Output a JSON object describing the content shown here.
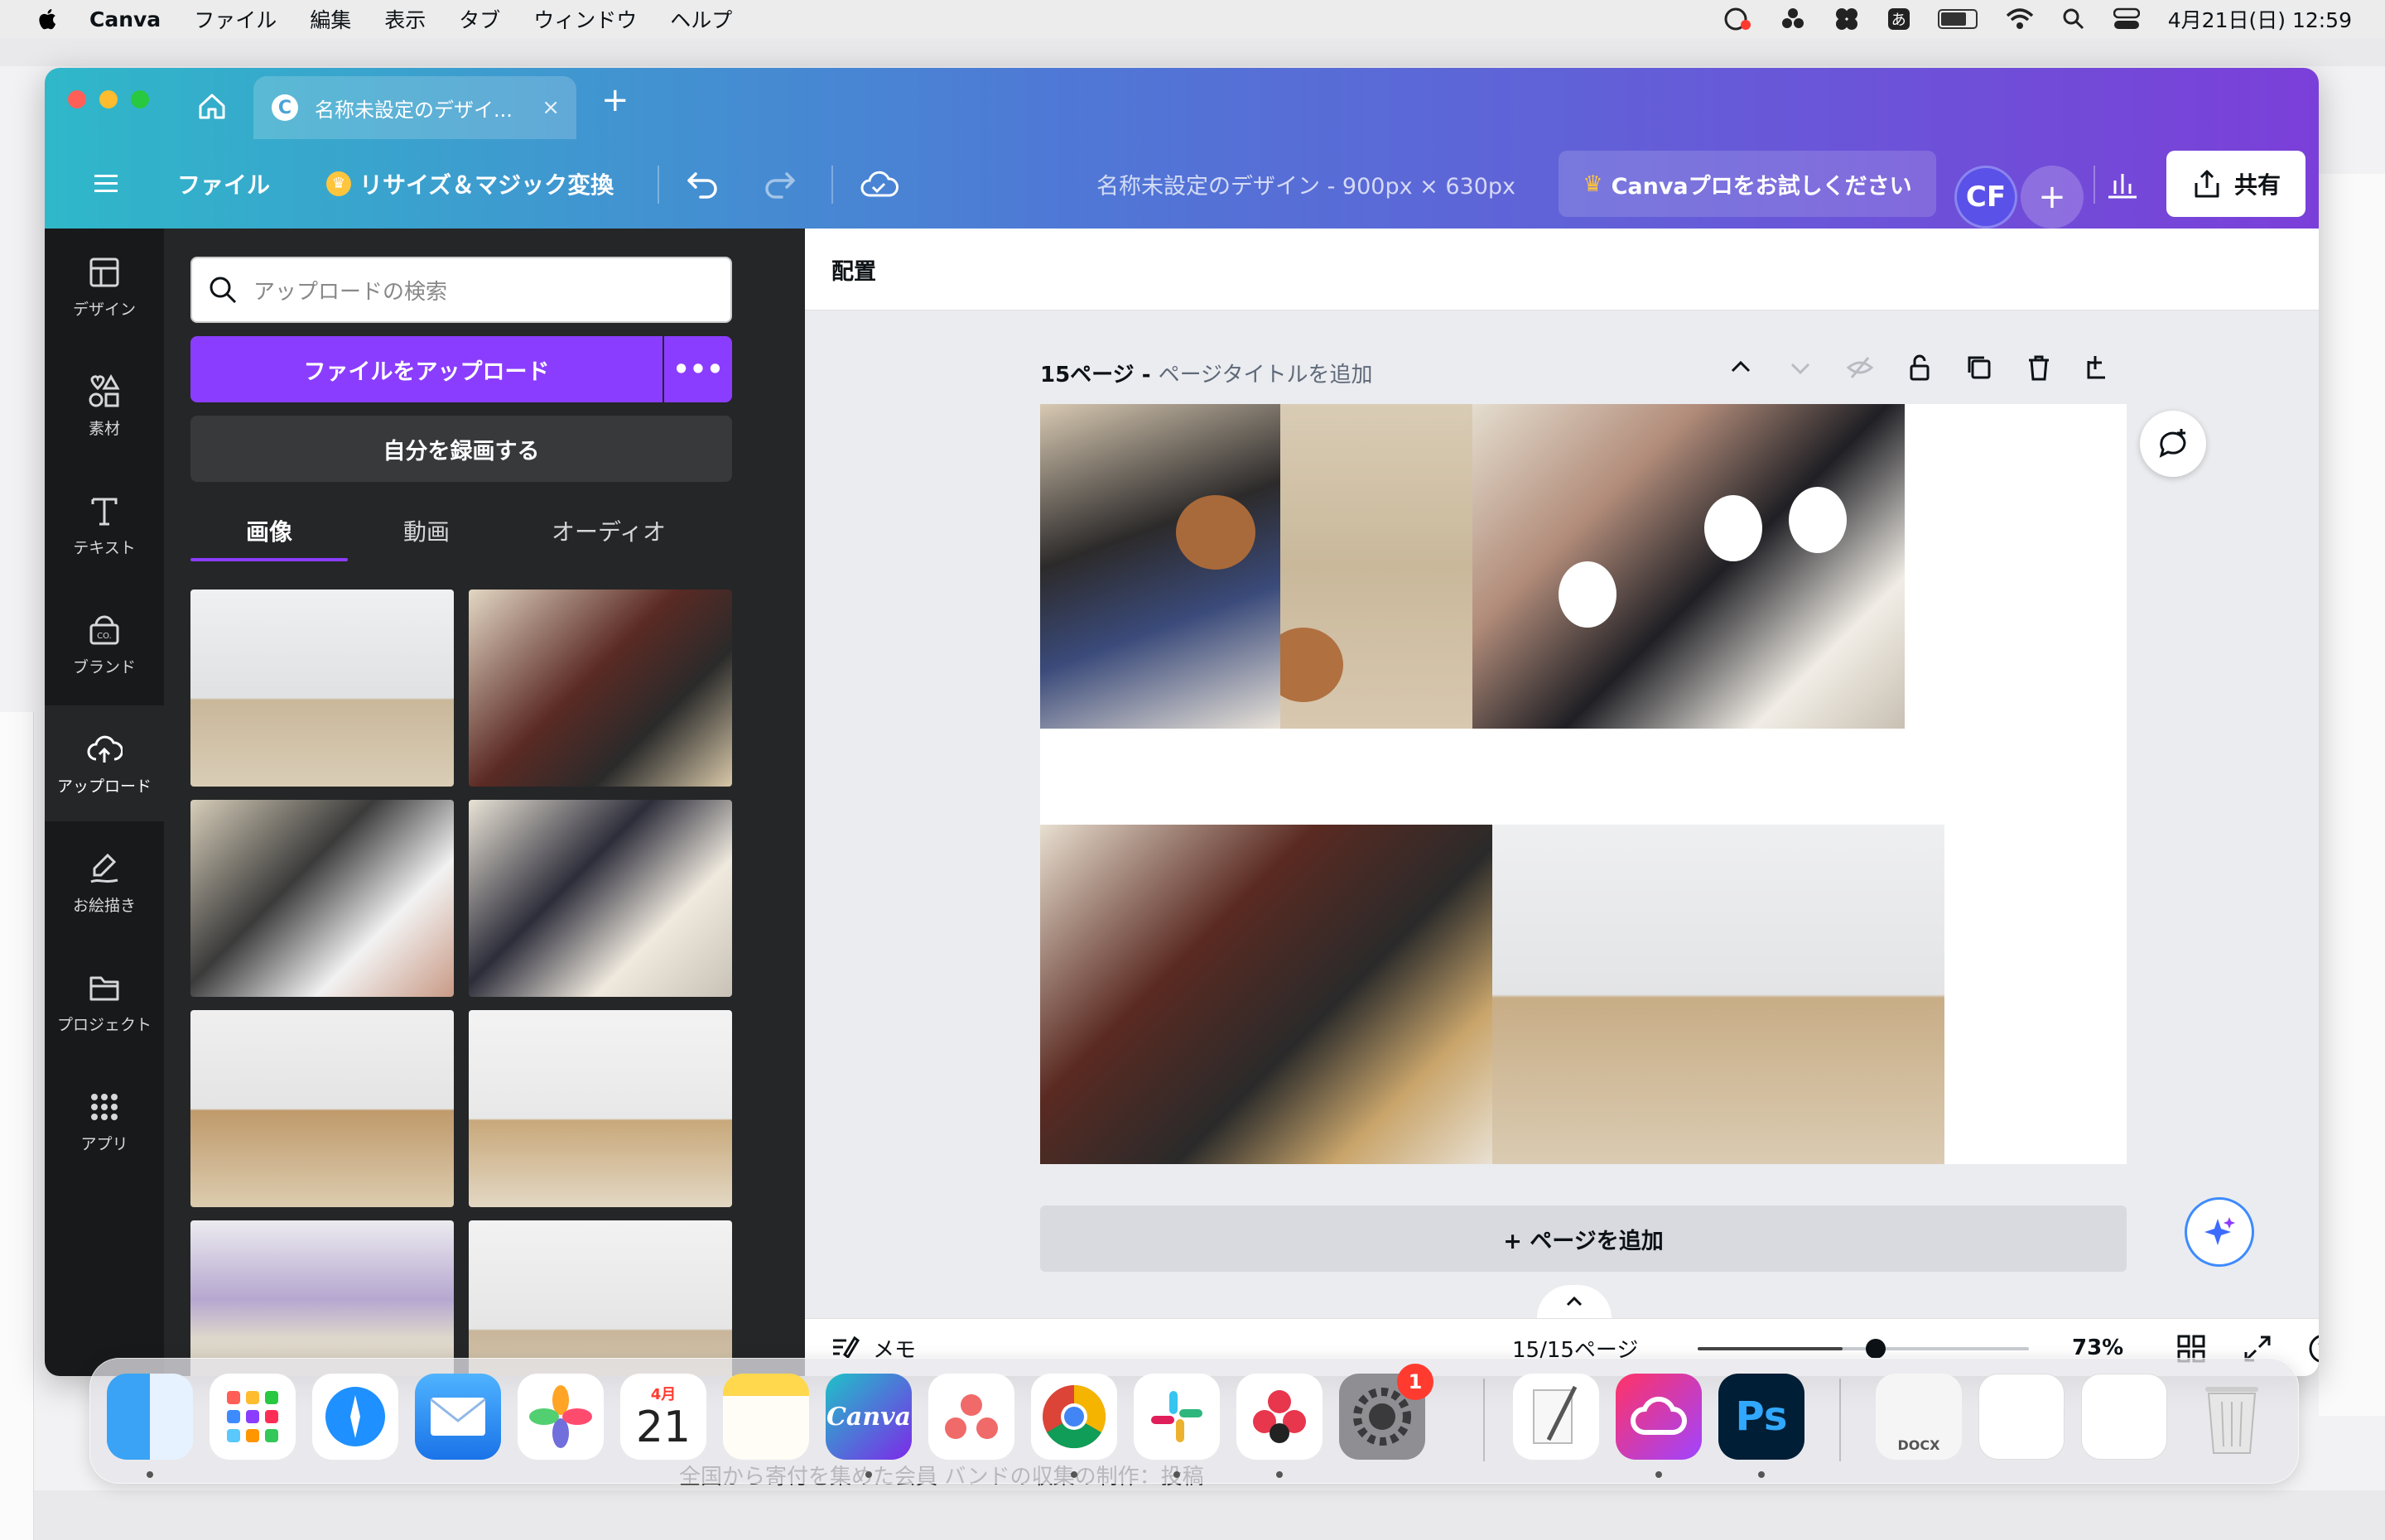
{
  "menubar": {
    "app": "Canva",
    "items": [
      "ファイル",
      "編集",
      "表示",
      "タブ",
      "ウィンドウ",
      "ヘルプ"
    ],
    "ime": "あ",
    "datetime": "4月21日(日)  12:59"
  },
  "browser": {
    "tab_title": "名称未設定のデザイ...",
    "tab_close": "×",
    "new_tab": "+"
  },
  "toolbar": {
    "file": "ファイル",
    "resize": "リサイズ＆マジック変換",
    "design_title": "名称未設定のデザイン - 900px × 630px",
    "pro": "Canvaプロをお試しください",
    "avatar": "CF",
    "add": "+",
    "share": "共有"
  },
  "rail": [
    {
      "label": "デザイン",
      "icon": "layout-icon"
    },
    {
      "label": "素材",
      "icon": "elements-icon"
    },
    {
      "label": "テキスト",
      "icon": "text-icon"
    },
    {
      "label": "ブランド",
      "icon": "brand-icon"
    },
    {
      "label": "アップロード",
      "icon": "upload-icon"
    },
    {
      "label": "お絵描き",
      "icon": "draw-icon"
    },
    {
      "label": "プロジェクト",
      "icon": "folder-icon"
    },
    {
      "label": "アプリ",
      "icon": "apps-icon"
    }
  ],
  "panel": {
    "search_placeholder": "アップロードの検索",
    "upload": "ファイルをアップロード",
    "more": "•••",
    "record": "自分を録画する",
    "tabs": [
      "画像",
      "動画",
      "オーディオ"
    ]
  },
  "editor": {
    "context": "配置",
    "page_label": "15ページ - ",
    "page_title_placeholder": "ページタイトルを追加",
    "add_page": "+ ページを追加",
    "notes": "メモ",
    "page_count": "15/15ページ",
    "zoom": "73%",
    "zoom_fraction": 0.73
  },
  "bg": {
    "bottom_text": "全国から寄付を集めた会員 バンドの収集の制作：投稿"
  },
  "dock": {
    "calendar_month": "4月",
    "calendar_day": "21",
    "canva": "Canva",
    "settings_badge": "1",
    "ps": "Ps",
    "docx": "DOCX"
  }
}
